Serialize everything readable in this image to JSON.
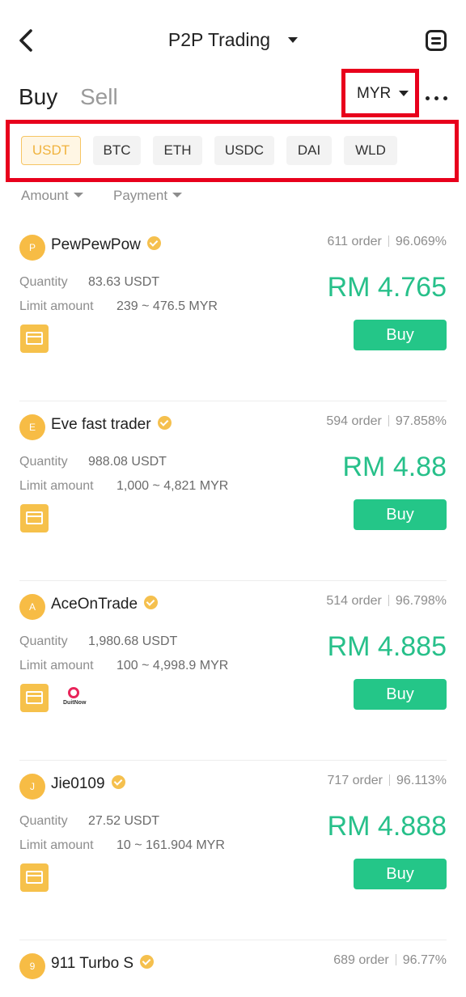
{
  "header": {
    "title": "P2P Trading"
  },
  "tabs": {
    "buy": "Buy",
    "sell": "Sell"
  },
  "currency": "MYR",
  "coins": [
    {
      "label": "USDT",
      "active": true
    },
    {
      "label": "BTC",
      "active": false
    },
    {
      "label": "ETH",
      "active": false
    },
    {
      "label": "USDC",
      "active": false
    },
    {
      "label": "DAI",
      "active": false
    },
    {
      "label": "WLD",
      "active": false
    }
  ],
  "filters": {
    "amount": "Amount",
    "payment": "Payment"
  },
  "labels": {
    "quantity": "Quantity",
    "limit": "Limit amount",
    "buy": "Buy",
    "duitnow": "DuitNow"
  },
  "ads": [
    {
      "initial": "P",
      "name": "PewPewPow",
      "orders": "611 order",
      "completion": "96.069%",
      "quantity": "83.63  USDT",
      "limit": "239 ~ 476.5 MYR",
      "price": "RM 4.765"
    },
    {
      "initial": "E",
      "name": "Eve fast trader",
      "orders": "594 order",
      "completion": "97.858%",
      "quantity": "988.08  USDT",
      "limit": "1,000 ~ 4,821 MYR",
      "price": "RM 4.88"
    },
    {
      "initial": "A",
      "name": "AceOnTrade",
      "orders": "514 order",
      "completion": "96.798%",
      "quantity": "1,980.68  USDT",
      "limit": "100 ~ 4,998.9 MYR",
      "price": "RM 4.885"
    },
    {
      "initial": "J",
      "name": "Jie0109",
      "orders": "717 order",
      "completion": "96.113%",
      "quantity": "27.52  USDT",
      "limit": "10 ~ 161.904 MYR",
      "price": "RM 4.888"
    },
    {
      "initial": "9",
      "name": "911 Turbo S",
      "orders": "689 order",
      "completion": "96.77%"
    }
  ],
  "colors": {
    "accent_green": "#24c688",
    "accent_gold": "#f6c14b",
    "highlight_red": "#e8001c"
  }
}
